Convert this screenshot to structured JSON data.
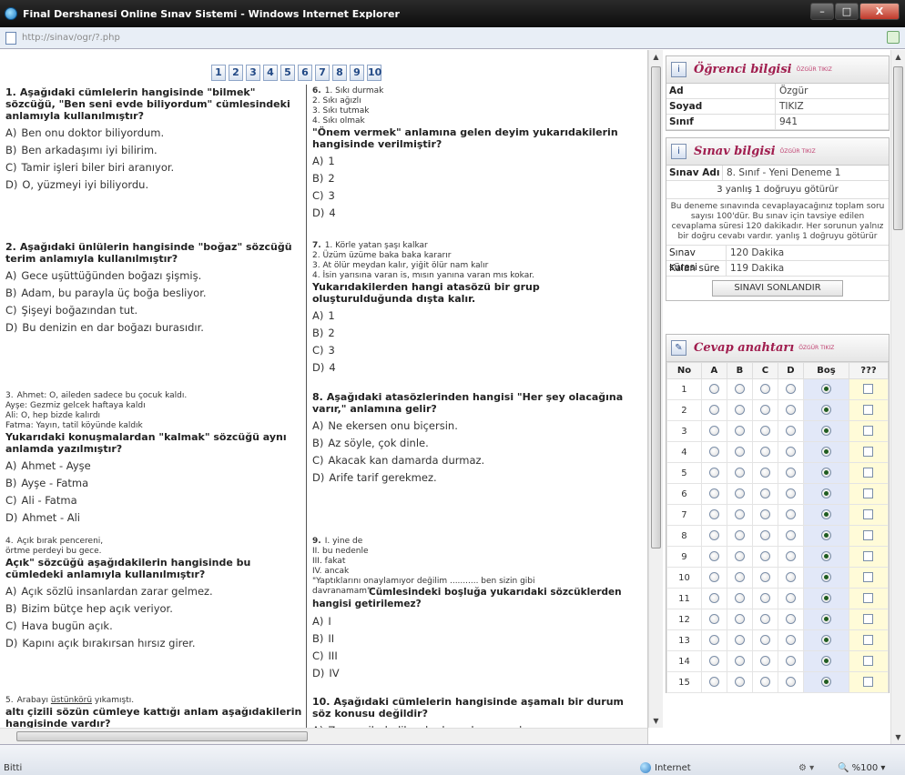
{
  "window": {
    "title": "Final Dershanesi Online Sınav Sistemi - Windows Internet Explorer",
    "minimize": "–",
    "maximize": "□",
    "close": "X"
  },
  "address": {
    "url": "http://sinav/ogr/?.php"
  },
  "question_nav": [
    "1",
    "2",
    "3",
    "4",
    "5",
    "6",
    "7",
    "8",
    "9",
    "10"
  ],
  "questions": [
    {
      "num": "1.",
      "stem": "Aşağıdaki cümlelerin hangisinde \"bilmek\" sözcüğü, \"Ben seni evde biliyordum\" cümlesindeki anlamıyla kullanılmıştır?",
      "options": [
        "Ben onu doktor biliyordum.",
        "Ben arkadaşımı iyi bilirim.",
        "Tamir işleri biler biri aranıyor.",
        "O, yüzmeyi iyi biliyordu."
      ]
    },
    {
      "num": "2.",
      "stem": "Aşağıdaki ünlülerin hangisinde \"boğaz\" sözcüğü terim anlamıyla kullanılmıştır?",
      "options": [
        "Gece uşüttüğünden boğazı şişmiş.",
        "Adam, bu parayla üç boğa besliyor.",
        "Şişeyi boğazından tut.",
        "Bu denizin en dar boğazı burasıdır."
      ]
    },
    {
      "num": "3.",
      "lines": [
        "Ahmet: O, aileden sadece bu çocuk kaldı.",
        "Ayşe: Gezmiz gelcek haftaya kaldı",
        "Ali: O, hep bizde kalırdı",
        "Fatma: Yayın, tatil köyünde kaldık"
      ],
      "stem": "Yukarıdaki konuşmalardan \"kalmak\" sözcüğü aynı anlamda yazılmıştır?",
      "options": [
        "Ahmet - Ayşe",
        "Ayşe - Fatma",
        "Ali - Fatma",
        "Ahmet - Ali"
      ]
    },
    {
      "num": "4.",
      "lines": [
        "Açık bırak pencereni,",
        "örtme perdeyi bu gece."
      ],
      "stem": "Açık\" sözcüğü aşağıdakilerin hangisinde bu cümledeki anlamıyla kullanılmıştır?",
      "options": [
        "Açık sözlü insanlardan zarar gelmez.",
        "Bizim bütçe hep açık veriyor.",
        "Hava bugün açık.",
        "Kapını açık bırakırsan hırsız girer."
      ]
    },
    {
      "num": "5.",
      "line_pre": "Arabayı ",
      "line_u": "üstünkörü",
      "line_post": " yıkamıştı.",
      "stem": "altı çizili sözün cümleye kattığı anlam aşağıdakilerin hangisinde vardır?"
    },
    {
      "num": "6.",
      "lines": [
        "1. Sıkı durmak",
        "2. Sıkı ağızlı",
        "3. Sıkı tutmak",
        "4. Sıkı olmak"
      ],
      "stem": "\"Önem vermek\" anlamına gelen deyim yukarıdakilerin hangisinde verilmiştir?",
      "options": [
        "1",
        "2",
        "3",
        "4"
      ]
    },
    {
      "num": "7.",
      "lines": [
        "1. Körle yatan şaşı kalkar",
        "2. Üzüm üzüme baka baka kararır",
        "3. At ölür meydan kalır, yiğit ölür nam kalır",
        "4. İsin yarısına varan is, mısın yanına varan mıs kokar."
      ],
      "stem": "Yukarıdakilerden hangi atasözü bir grup oluşturulduğunda dışta kalır.",
      "options": [
        "1",
        "2",
        "3",
        "4"
      ]
    },
    {
      "num": "8.",
      "stem": "Aşağıdaki atasözlerinden hangisi \"Her şey olacağına varır,\" anlamına gelir?",
      "options": [
        "Ne ekersen onu biçersin.",
        "Az söyle, çok dinle.",
        "Akacak kan damarda durmaz.",
        "Arife tarif gerekmez."
      ]
    },
    {
      "num": "9.",
      "lines": [
        "I. yine de",
        "II. bu nedenle",
        "III. fakat",
        "IV. ancak",
        "\"Yaptıklarını onaylamıyor değilim ........... ben sizin gibi"
      ],
      "line_last": "davranamam\"",
      "stem": "Cümlesindeki boşluğa yukarıdaki sözcüklerden hangisi getirilemez?",
      "options": [
        "I",
        "II",
        "III",
        "IV"
      ]
    },
    {
      "num": "10.",
      "stem": "Aşağıdaki cümlelerin hangisinde aşamalı bir durum söz konusu değildir?",
      "options": [
        "Zaman ilerledikçe bu konuda uzmanlaşıyorum."
      ]
    }
  ],
  "option_letters": [
    "A)",
    "B)",
    "C)",
    "D)"
  ],
  "student": {
    "title": "Öğrenci bilgisi",
    "owner": "ÖZGÜR TIKIZ",
    "rows": [
      {
        "key": "Ad",
        "value": "Özgür"
      },
      {
        "key": "Soyad",
        "value": "TIKIZ"
      },
      {
        "key": "Sınıf",
        "value": "941"
      }
    ]
  },
  "exam": {
    "title": "Sınav bilgisi",
    "owner": "ÖZGÜR TIKIZ",
    "name_key": "Sınav Adı",
    "name_value": "8. Sınıf - Yeni Deneme 1",
    "rule": "3 yanlış 1 doğruyu götürür",
    "description": "Bu deneme sınavında cevaplayacağınız toplam soru sayısı 100'dür. Bu sınav için tavsiye edilen cevaplama süresi 120 dakikadır. Her sorunun yalnız bir doğru cevabı vardır. yanlış 1 doğruyu götürür",
    "duration_key": "Sınav süresi",
    "duration_value": "120 Dakika",
    "remaining_key": "Kalan süre",
    "remaining_value": "119 Dakika",
    "end_button": "SINAVI SONLANDIR"
  },
  "answer_key": {
    "title": "Cevap anahtarı",
    "owner": "ÖZGÜR TIKIZ",
    "columns": [
      "No",
      "A",
      "B",
      "C",
      "D",
      "Boş",
      "???"
    ],
    "rows": [
      "1",
      "2",
      "3",
      "4",
      "5",
      "6",
      "7",
      "8",
      "9",
      "10",
      "11",
      "12",
      "13",
      "14",
      "15"
    ]
  },
  "status": {
    "text": "Bitti",
    "zone": "Internet",
    "zoom": "%100"
  }
}
